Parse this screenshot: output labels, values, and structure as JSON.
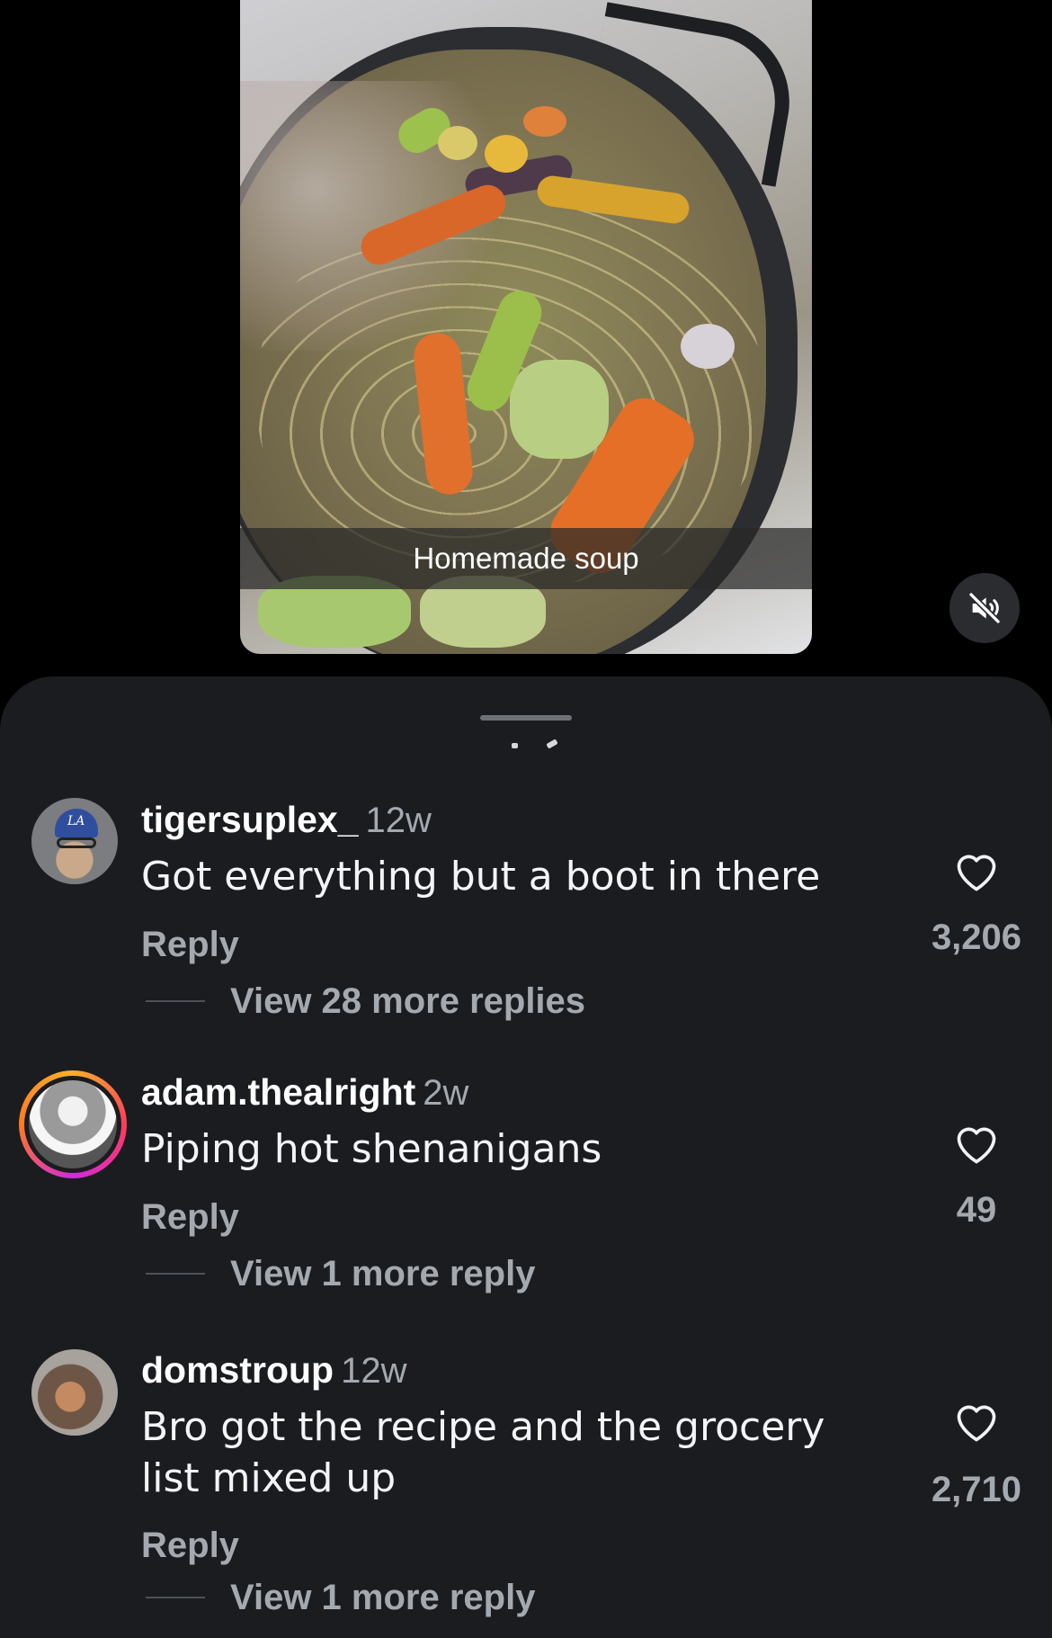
{
  "video": {
    "caption": "Homemade soup",
    "mute_icon": "speaker-muted-icon"
  },
  "comments": [
    {
      "username": "tigersuplex_",
      "time": "12w",
      "text": "Got everything but a boot in there",
      "reply_label": "Reply",
      "view_replies": "View 28 more replies",
      "likes": "3,206",
      "has_story_ring": false
    },
    {
      "username": "adam.thealright",
      "time": "2w",
      "text": "Piping hot shenanigans",
      "reply_label": "Reply",
      "view_replies": "View 1 more reply",
      "likes": "49",
      "has_story_ring": true
    },
    {
      "username": "domstroup",
      "time": "12w",
      "text_line1": "Bro got the recipe and the grocery",
      "text_line2": "list mixed up",
      "reply_label": "Reply",
      "view_replies": "View 1 more reply",
      "likes": "2,710",
      "has_story_ring": false
    }
  ],
  "colors": {
    "sheet_bg": "#1a1c1f",
    "secondary_text": "#a4a9b0",
    "primary_text": "#ffffff"
  }
}
